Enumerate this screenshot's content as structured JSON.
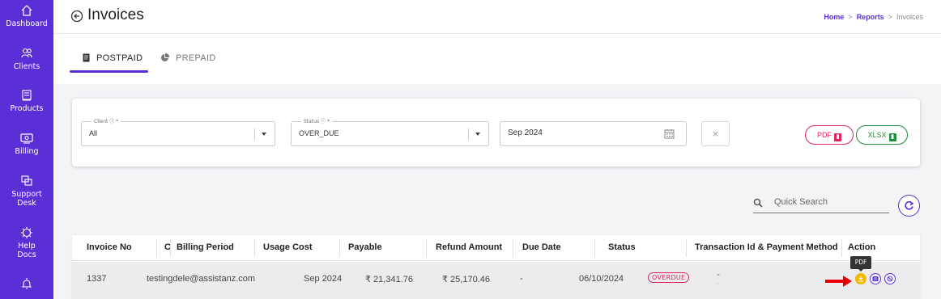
{
  "sidebar": {
    "items": [
      {
        "label": "Dashboard",
        "icon": "home-icon"
      },
      {
        "label": "Clients",
        "icon": "users-icon"
      },
      {
        "label": "Products",
        "icon": "box-icon"
      },
      {
        "label": "Billing",
        "icon": "billing-icon"
      },
      {
        "label": "Support Desk",
        "label1": "Support",
        "label2": "Desk",
        "icon": "support-icon"
      },
      {
        "label": "Help Docs",
        "label1": "Help",
        "label2": "Docs",
        "icon": "help-icon"
      },
      {
        "label": "",
        "icon": "bell-icon"
      }
    ]
  },
  "header": {
    "title": "Invoices",
    "breadcrumb": [
      "Home",
      "Reports",
      "Invoices"
    ]
  },
  "tabs": [
    {
      "label": "POSTPAID",
      "active": true
    },
    {
      "label": "PREPAID",
      "active": false
    }
  ],
  "filters": {
    "client": {
      "label": "Client ⓘ *",
      "value": "All"
    },
    "status": {
      "label": "Status ⓘ *",
      "value": "OVER_DUE"
    },
    "month": {
      "value": "Sep 2024"
    },
    "clear_label": "×",
    "pdf_label": "PDF",
    "xlsx_label": "XLSX"
  },
  "search": {
    "placeholder": "Quick Search"
  },
  "table": {
    "columns": [
      "Invoice No",
      "C",
      "Billing Period",
      "Usage Cost",
      "Payable",
      "Refund Amount",
      "Due Date",
      "Status",
      "Transaction Id & Payment Method",
      "Action"
    ],
    "rows": [
      {
        "invoice_no": "1337",
        "client": "testingdele@assistanz.com",
        "billing_period": "Sep 2024",
        "usage_cost": "₹ 21,341.76",
        "payable": "₹ 25,170.46",
        "refund_amount": "-",
        "due_date": "06/10/2024",
        "status": "OVERDUE",
        "transaction": "-",
        "transaction_sub": "-"
      }
    ]
  },
  "tooltip": "PDF",
  "colors": {
    "primary": "#5b2fd6",
    "danger": "#e0245e",
    "success": "#1e8c3a",
    "warning": "#f5b800",
    "annotation": "#e60000"
  }
}
